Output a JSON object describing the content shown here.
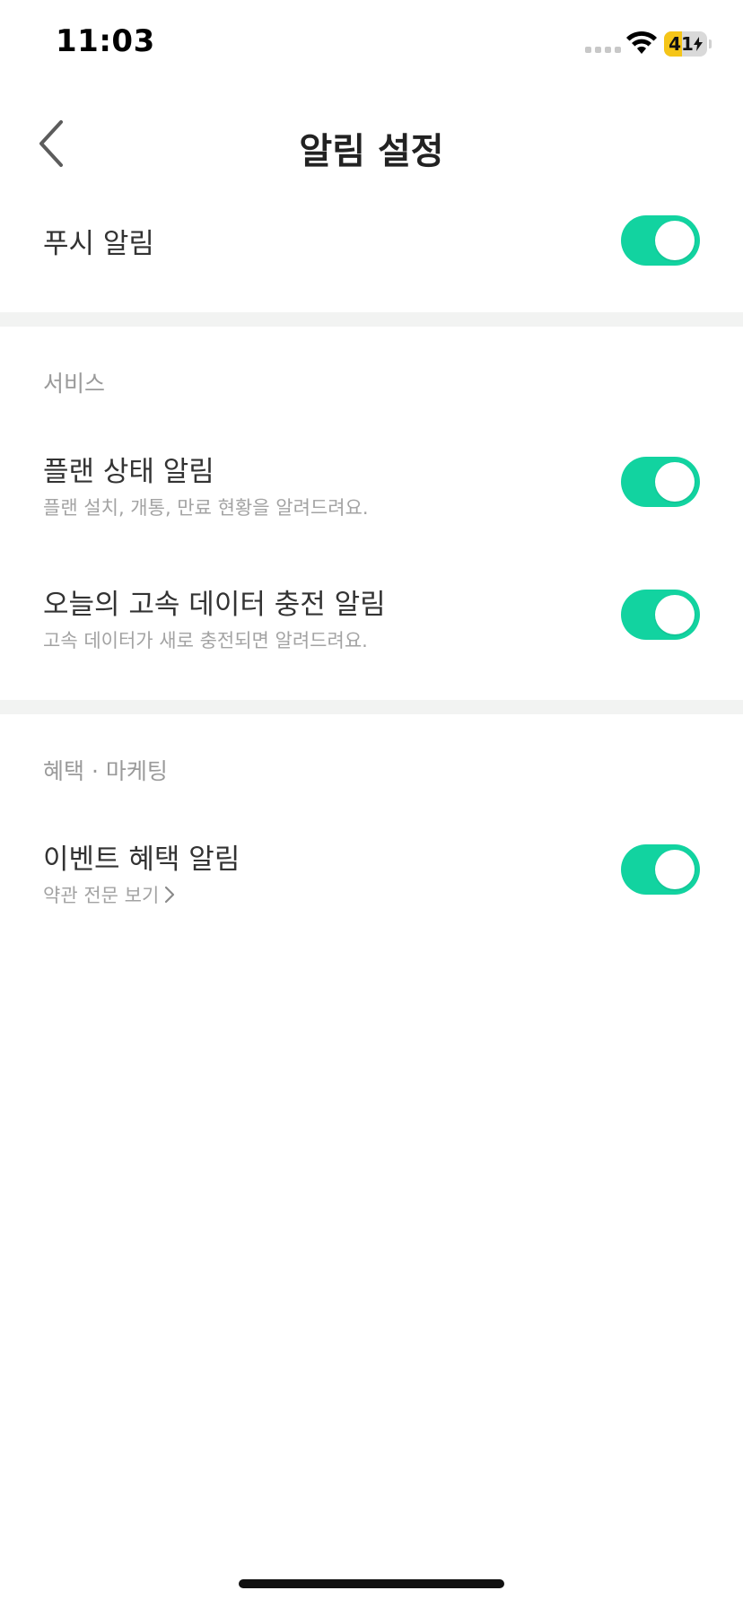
{
  "status_bar": {
    "time": "11:03",
    "battery_level": "41",
    "battery_percent": 41,
    "battery_color": "#f5c518",
    "signal_icon": "cellular-dots-icon",
    "wifi_icon": "wifi-icon",
    "charging_icon": "bolt-icon"
  },
  "header": {
    "title": "알림 설정",
    "back_icon": "chevron-left-icon"
  },
  "accent_color": "#12d3a0",
  "push": {
    "label": "푸시 알림",
    "enabled": true
  },
  "sections": {
    "service": {
      "header": "서비스",
      "items": [
        {
          "title": "플랜 상태 알림",
          "subtitle": "플랜 설치, 개통, 만료 현황을 알려드려요.",
          "enabled": true
        },
        {
          "title": "오늘의 고속 데이터 충전 알림",
          "subtitle": "고속 데이터가 새로 충전되면 알려드려요.",
          "enabled": true
        }
      ]
    },
    "marketing": {
      "header": "혜택 · 마케팅",
      "items": [
        {
          "title": "이벤트 혜택 알림",
          "link_label": "약관 전문 보기",
          "enabled": true
        }
      ]
    }
  }
}
